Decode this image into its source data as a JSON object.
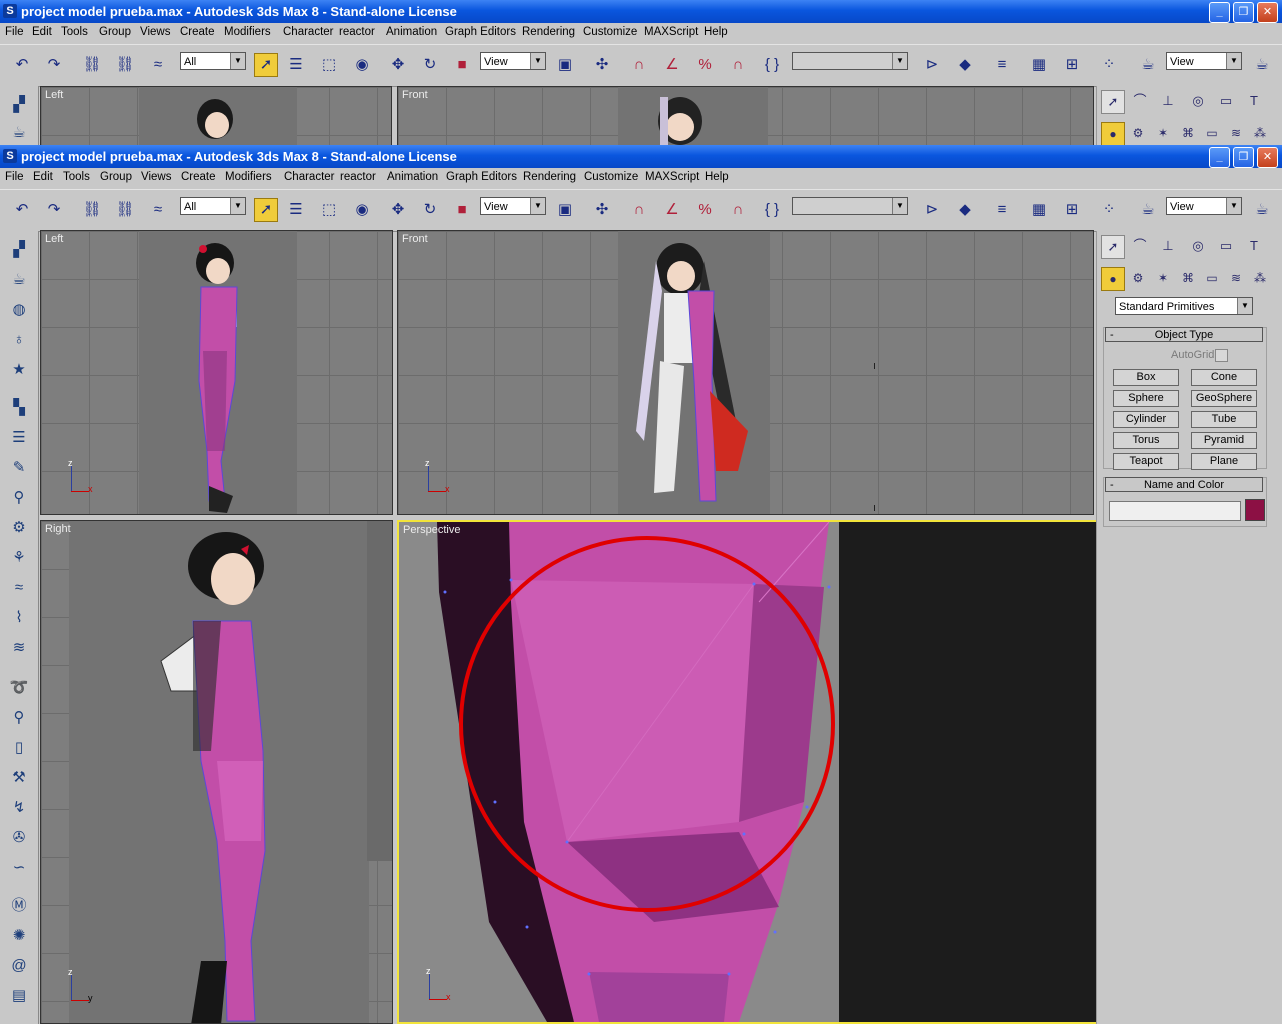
{
  "title": "project model prueba.max - Autodesk 3ds Max 8  - Stand-alone License",
  "menu": [
    "File",
    "Edit",
    "Tools",
    "Group",
    "Views",
    "Create",
    "Modifiers",
    "Character",
    "reactor",
    "Animation",
    "Graph Editors",
    "Rendering",
    "Customize",
    "MAXScript",
    "Help"
  ],
  "toolbar": {
    "selection_filter": "All",
    "reference_coord": "View",
    "render_view": "View"
  },
  "viewports": {
    "left": "Left",
    "front": "Front",
    "right": "Right",
    "perspective": "Perspective"
  },
  "axis": {
    "z": "z",
    "x": "x",
    "y": "y"
  },
  "command_panel": {
    "category": "Standard Primitives",
    "object_type_title": "Object Type",
    "autogrid": "AutoGrid",
    "buttons": [
      "Box",
      "Cone",
      "Sphere",
      "GeoSphere",
      "Cylinder",
      "Tube",
      "Torus",
      "Pyramid",
      "Teapot",
      "Plane"
    ],
    "name_color_title": "Name and Color"
  },
  "colors": {
    "active_tool": "#f0cc3a",
    "mesh_pink": "#c24ea8",
    "annotation_circle": "#e00000",
    "object_color": "#8c1044"
  }
}
